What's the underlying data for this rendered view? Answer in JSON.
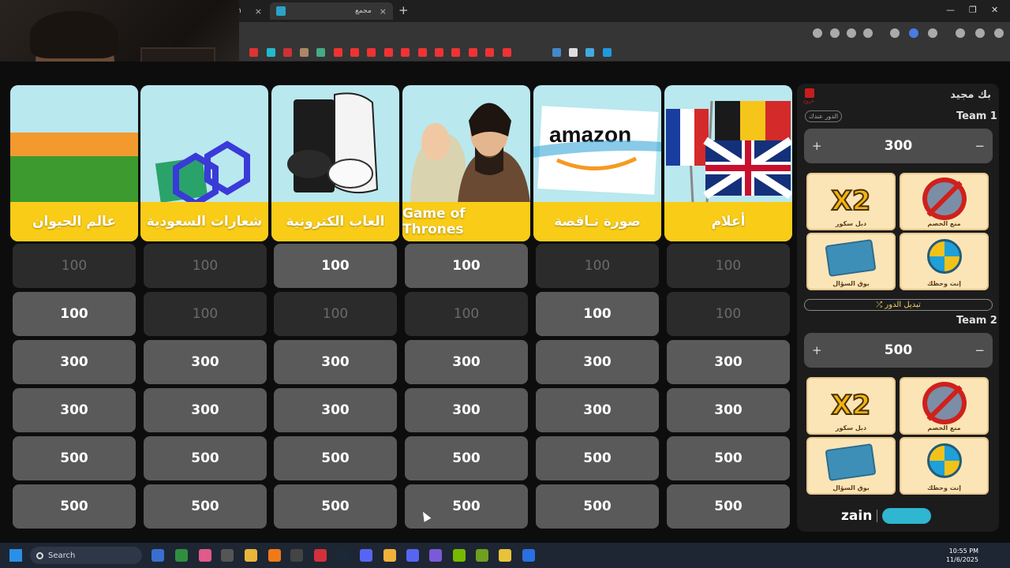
{
  "browser": {
    "tabs": [
      {
        "label": "n"
      },
      {
        "label": "مجمع"
      }
    ],
    "new_tab": "+",
    "close_glyph": "×",
    "window_controls": {
      "minimize": "—",
      "maximize": "❐",
      "close": "✕"
    }
  },
  "board": {
    "categories": [
      {
        "label": "عالم الحيوان",
        "icon": "animals-image"
      },
      {
        "label": "شعارات السعودية",
        "icon": "saudi-logos-image"
      },
      {
        "label": "العاب الكترونية",
        "icon": "game-consoles-image"
      },
      {
        "label": "Game of Thrones",
        "icon": "game-of-thrones-image"
      },
      {
        "label": "صورة نـاقصة",
        "icon": "amazon-logo-image"
      },
      {
        "label": "أعلام",
        "icon": "flags-image"
      }
    ],
    "rows": [
      [
        {
          "v": "100",
          "s": "off"
        },
        {
          "v": "100",
          "s": "off"
        },
        {
          "v": "100",
          "s": "on"
        },
        {
          "v": "100",
          "s": "on"
        },
        {
          "v": "100",
          "s": "off"
        },
        {
          "v": "100",
          "s": "off"
        }
      ],
      [
        {
          "v": "100",
          "s": "on"
        },
        {
          "v": "100",
          "s": "off"
        },
        {
          "v": "100",
          "s": "off"
        },
        {
          "v": "100",
          "s": "off"
        },
        {
          "v": "100",
          "s": "on"
        },
        {
          "v": "100",
          "s": "off"
        }
      ],
      [
        {
          "v": "300",
          "s": "on"
        },
        {
          "v": "300",
          "s": "on"
        },
        {
          "v": "300",
          "s": "on"
        },
        {
          "v": "300",
          "s": "on"
        },
        {
          "v": "300",
          "s": "on"
        },
        {
          "v": "300",
          "s": "on"
        }
      ],
      [
        {
          "v": "300",
          "s": "on"
        },
        {
          "v": "300",
          "s": "on"
        },
        {
          "v": "300",
          "s": "on"
        },
        {
          "v": "300",
          "s": "on"
        },
        {
          "v": "300",
          "s": "on"
        },
        {
          "v": "300",
          "s": "on"
        }
      ],
      [
        {
          "v": "500",
          "s": "on"
        },
        {
          "v": "500",
          "s": "on"
        },
        {
          "v": "500",
          "s": "on"
        },
        {
          "v": "500",
          "s": "on"
        },
        {
          "v": "500",
          "s": "on"
        },
        {
          "v": "500",
          "s": "on"
        }
      ],
      [
        {
          "v": "500",
          "s": "on"
        },
        {
          "v": "500",
          "s": "on"
        },
        {
          "v": "500",
          "s": "on"
        },
        {
          "v": "500",
          "s": "on"
        },
        {
          "v": "500",
          "s": "on"
        },
        {
          "v": "500",
          "s": "on"
        }
      ]
    ]
  },
  "sidebar": {
    "game_name": "بك مجيد",
    "exit_label": "خروج",
    "turn_badge": "الدور عندك",
    "switch_turn": "⤮ تبديل الدور",
    "team1": {
      "name": "Team 1",
      "score": "300"
    },
    "team2": {
      "name": "Team 2",
      "score": "500"
    },
    "plus": "+",
    "minus": "−",
    "powerups": {
      "x2_text": "X2",
      "double": "دبل سكور",
      "block": "منع الخصم",
      "steal": "بوق السؤال",
      "wheel": "إنت وحظك"
    },
    "brand": "zain"
  },
  "taskbar": {
    "search": "Search",
    "time": "10:55 PM",
    "date": "11/6/2025"
  },
  "colors": {
    "category_label": "#f9cc18",
    "cell_active": "#5a5a5a",
    "cell_used": "#2b2b2b",
    "score_box": "#4d4d4d"
  }
}
